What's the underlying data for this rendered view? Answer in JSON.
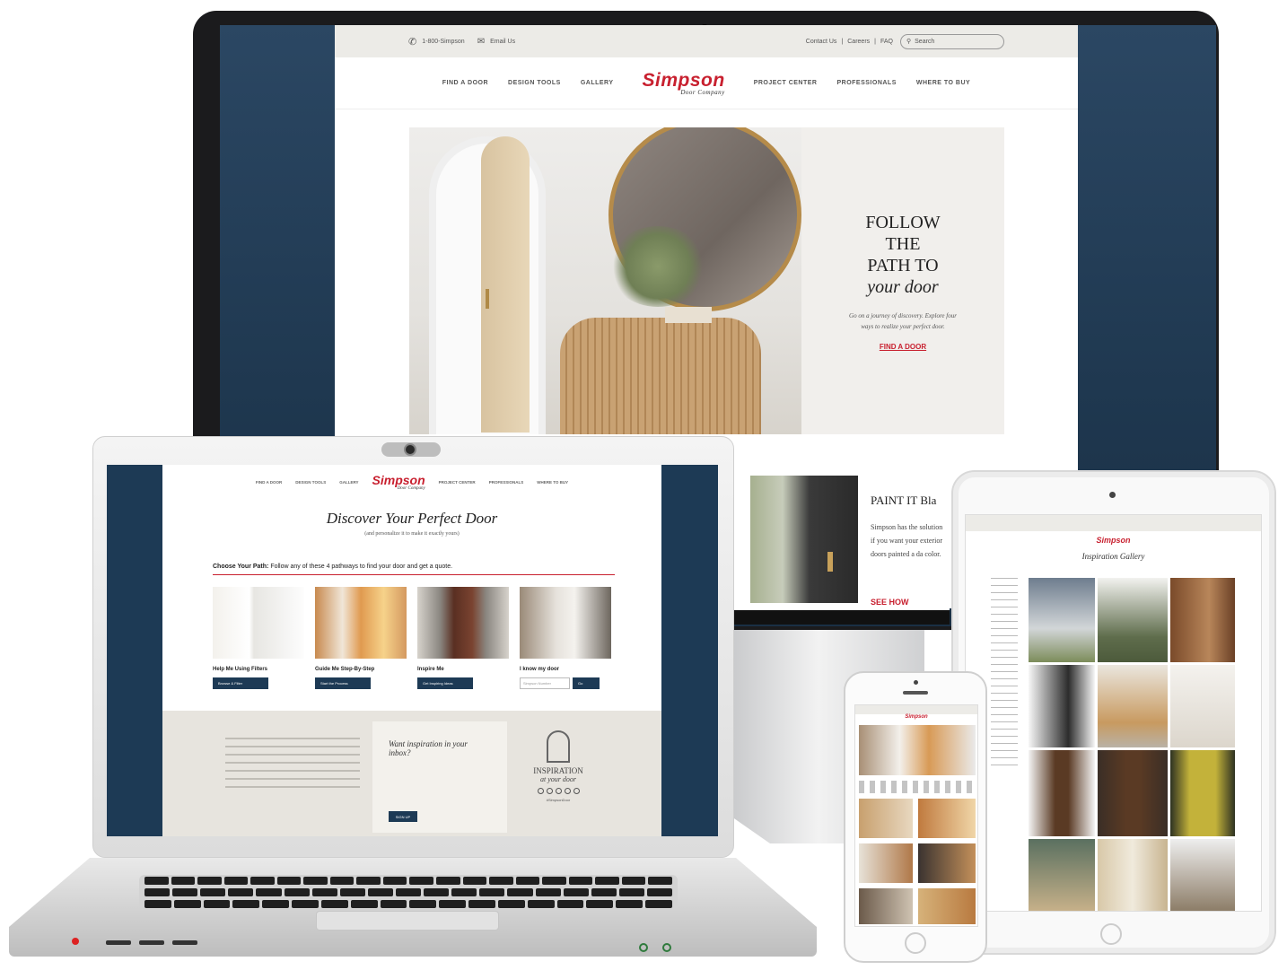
{
  "desktop": {
    "topbar": {
      "phone": "1-800-Simpson",
      "email": "Email Us",
      "links": [
        "Contact Us",
        "Careers",
        "FAQ"
      ],
      "search_placeholder": "Search"
    },
    "nav_left": [
      "FIND A DOOR",
      "DESIGN TOOLS",
      "GALLERY"
    ],
    "nav_right": [
      "PROJECT CENTER",
      "PROFESSIONALS",
      "WHERE TO BUY"
    ],
    "logo": {
      "name": "Simpson",
      "sub": "Door Company"
    },
    "hero": {
      "line1": "FOLLOW",
      "line2": "THE",
      "line3": "PATH TO",
      "line4": "your door",
      "body": "Go on a journey of discovery. Explore four ways to realize your perfect door.",
      "cta": "FIND A DOOR"
    },
    "paint": {
      "heading": "PAINT IT Bla",
      "body": "Simpson has the solution if you want your exterior doors painted a da color.",
      "cta": "SEE HOW"
    }
  },
  "laptop": {
    "nav": [
      "FIND A DOOR",
      "DESIGN TOOLS",
      "GALLERY",
      "PROJECT CENTER",
      "PROFESSIONALS",
      "WHERE TO BUY"
    ],
    "headline": "Discover Your Perfect Door",
    "subhead": "(and personalize it to make it exactly yours)",
    "path_label": "Choose Your Path:",
    "path_text": "Follow any of these 4 pathways to find your door and get a quote.",
    "cards": [
      {
        "title": "Help Me Using Filters",
        "button": "Browse & Filter"
      },
      {
        "title": "Guide Me Step-By-Step",
        "button": "Start the Process"
      },
      {
        "title": "Inspire Me",
        "button": "Get Inspiring Ideas"
      },
      {
        "title": "I know my door",
        "button": "Go",
        "placeholder": "Simpson Number"
      }
    ],
    "footer": {
      "newsletter_title": "Want inspiration in your inbox?",
      "newsletter_btn": "SIGN UP",
      "brand_line1": "INSPIRATION",
      "brand_line2": "at your door",
      "hashtag": "#SimpsonDoor"
    }
  },
  "tablet": {
    "title": "Inspiration Gallery"
  },
  "colors": {
    "navy": "#1d3a55",
    "brand_red": "#c8202f",
    "beige": "#ecebe7"
  }
}
